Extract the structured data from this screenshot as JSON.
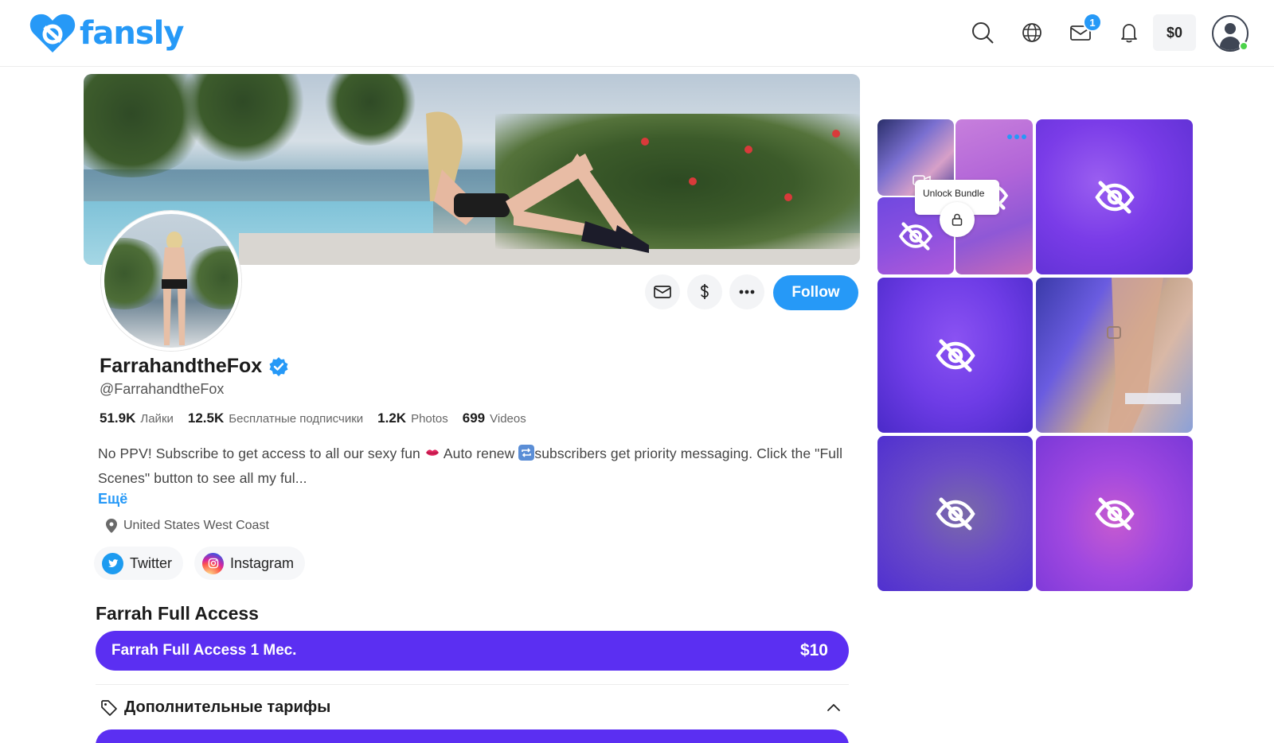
{
  "header": {
    "brand": "fansly",
    "icons": [
      "search-icon",
      "globe-icon",
      "mail-icon",
      "bell-icon"
    ],
    "messages_badge": "1",
    "wallet": "$0"
  },
  "profile": {
    "display_name": "FarrahandtheFox",
    "handle": "@FarrahandtheFox",
    "verified": true,
    "stats": [
      {
        "value": "51.9K",
        "label": "Лайки"
      },
      {
        "value": "12.5K",
        "label": "Бесплатные подписчики"
      },
      {
        "value": "1.2K",
        "label": "Photos"
      },
      {
        "value": "699",
        "label": "Videos"
      }
    ],
    "bio": {
      "part1": "No PPV! Subscribe to get access to all our sexy fun ",
      "part2": " Auto renew ",
      "part3": "subscribers get priority messaging. Click the \"Full Scenes\" button to see all my ful..."
    },
    "more": "Ещё",
    "location": "United States West Coast",
    "socials": [
      {
        "name": "Twitter"
      },
      {
        "name": "Instagram"
      }
    ],
    "follow_label": "Follow"
  },
  "subscription": {
    "title": "Farrah Full Access",
    "tier_name": "Farrah Full Access 1 Мес.",
    "tier_price": "$10",
    "extra_tiers_label": "Дополнительные тарифы"
  },
  "media": {
    "bundle_label": "Unlock Bundle",
    "bundle_count": "3"
  },
  "colors": {
    "brand": "#2699f7",
    "tier": "#5b2ff2",
    "online": "#4cd34a"
  }
}
